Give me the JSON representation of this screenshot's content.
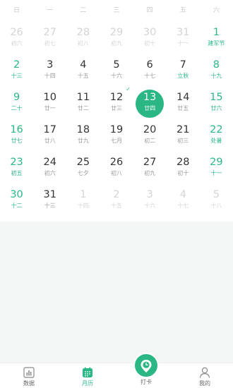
{
  "weekdays": [
    "日",
    "一",
    "二",
    "三",
    "四",
    "五",
    "六"
  ],
  "calendar": {
    "days": [
      {
        "day": "26",
        "lunar": "初六",
        "type": "other"
      },
      {
        "day": "27",
        "lunar": "初七",
        "type": "other"
      },
      {
        "day": "28",
        "lunar": "初八",
        "type": "other"
      },
      {
        "day": "29",
        "lunar": "初九",
        "type": "other"
      },
      {
        "day": "30",
        "lunar": "初十",
        "type": "other"
      },
      {
        "day": "31",
        "lunar": "十一",
        "type": "other"
      },
      {
        "day": "1",
        "lunar": "建军节",
        "type": "weekend"
      },
      {
        "day": "2",
        "lunar": "十三",
        "type": "weekend"
      },
      {
        "day": "3",
        "lunar": "十四",
        "type": "normal"
      },
      {
        "day": "4",
        "lunar": "十五",
        "type": "normal"
      },
      {
        "day": "5",
        "lunar": "十六",
        "type": "normal"
      },
      {
        "day": "6",
        "lunar": "十七",
        "type": "normal"
      },
      {
        "day": "7",
        "lunar": "立秋",
        "type": "festival"
      },
      {
        "day": "8",
        "lunar": "十九",
        "type": "weekend"
      },
      {
        "day": "9",
        "lunar": "二十",
        "type": "weekend"
      },
      {
        "day": "10",
        "lunar": "廿一",
        "type": "normal"
      },
      {
        "day": "11",
        "lunar": "廿二",
        "type": "normal"
      },
      {
        "day": "12",
        "lunar": "廿三",
        "type": "normal",
        "checked": true
      },
      {
        "day": "13",
        "lunar": "廿四",
        "type": "selected"
      },
      {
        "day": "14",
        "lunar": "廿五",
        "type": "normal"
      },
      {
        "day": "15",
        "lunar": "廿六",
        "type": "weekend"
      },
      {
        "day": "16",
        "lunar": "廿七",
        "type": "weekend"
      },
      {
        "day": "17",
        "lunar": "廿八",
        "type": "normal"
      },
      {
        "day": "18",
        "lunar": "廿九",
        "type": "normal"
      },
      {
        "day": "19",
        "lunar": "七月",
        "type": "normal"
      },
      {
        "day": "20",
        "lunar": "初二",
        "type": "normal"
      },
      {
        "day": "21",
        "lunar": "初三",
        "type": "normal"
      },
      {
        "day": "22",
        "lunar": "处暑",
        "type": "weekend"
      },
      {
        "day": "23",
        "lunar": "初五",
        "type": "weekend"
      },
      {
        "day": "24",
        "lunar": "初六",
        "type": "normal"
      },
      {
        "day": "25",
        "lunar": "七夕",
        "type": "normal"
      },
      {
        "day": "26",
        "lunar": "初八",
        "type": "normal"
      },
      {
        "day": "27",
        "lunar": "初九",
        "type": "normal"
      },
      {
        "day": "28",
        "lunar": "初十",
        "type": "normal"
      },
      {
        "day": "29",
        "lunar": "十一",
        "type": "weekend"
      },
      {
        "day": "30",
        "lunar": "十二",
        "type": "weekend"
      },
      {
        "day": "31",
        "lunar": "十三",
        "type": "normal"
      },
      {
        "day": "1",
        "lunar": "十四",
        "type": "other"
      },
      {
        "day": "2",
        "lunar": "十五",
        "type": "other"
      },
      {
        "day": "3",
        "lunar": "十六",
        "type": "other"
      },
      {
        "day": "4",
        "lunar": "十七",
        "type": "other"
      },
      {
        "day": "5",
        "lunar": "十八",
        "type": "other"
      }
    ]
  },
  "tabbar": {
    "data_label": "数据",
    "calendar_label": "月历",
    "checkin_label": "打卡",
    "mine_label": "我的"
  },
  "colors": {
    "accent": "#2ab784",
    "inactive_tab": "#666666",
    "muted_day": "#d4d4d4",
    "empty_area": "#f2f6f5"
  },
  "icons": {
    "data": "bar-chart-icon",
    "calendar": "calendar-icon",
    "checkin": "clock-pin-icon",
    "mine": "user-icon"
  }
}
